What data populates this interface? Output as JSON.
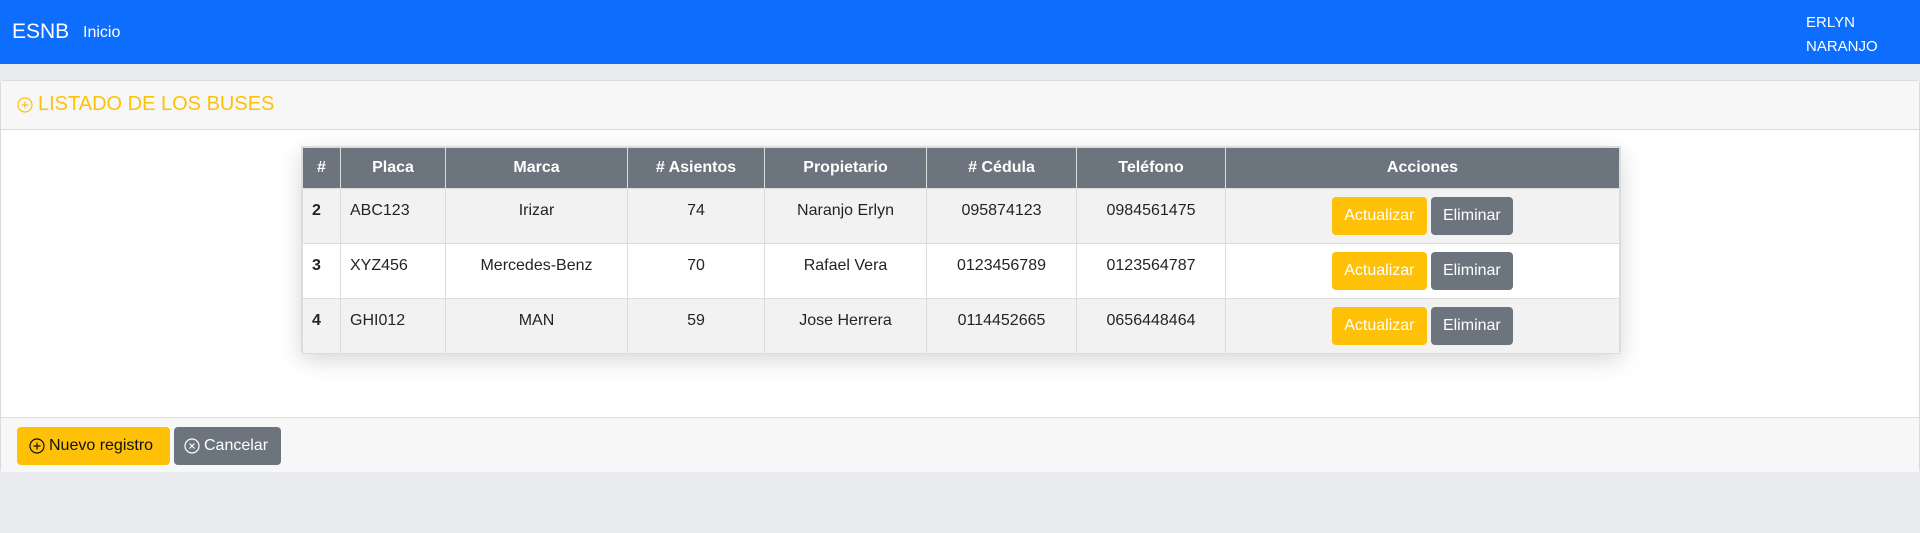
{
  "navbar": {
    "brand": "ESNB",
    "links": [
      "Inicio"
    ],
    "user_line1": "ERLYN",
    "user_line2": "NARANJO"
  },
  "card": {
    "title": "LISTADO DE LOS BUSES",
    "title_icon": "plus-circle-icon"
  },
  "table": {
    "headers": [
      "#",
      "Placa",
      "Marca",
      "# Asientos",
      "Propietario",
      "# Cédula",
      "Teléfono",
      "Acciones"
    ],
    "rows": [
      {
        "id": "2",
        "placa": "ABC123",
        "marca": "Irizar",
        "asientos": "74",
        "propietario": "Naranjo Erlyn",
        "cedula": "095874123",
        "telefono": "0984561475"
      },
      {
        "id": "3",
        "placa": "XYZ456",
        "marca": "Mercedes-Benz",
        "asientos": "70",
        "propietario": "Rafael Vera",
        "cedula": "0123456789",
        "telefono": "0123564787"
      },
      {
        "id": "4",
        "placa": "GHI012",
        "marca": "MAN",
        "asientos": "59",
        "propietario": "Jose Herrera",
        "cedula": "0114452665",
        "telefono": "0656448464"
      }
    ],
    "update_label": "Actualizar",
    "delete_label": "Eliminar"
  },
  "footer": {
    "new_label": "Nuevo registro",
    "new_icon": "plus-circle-icon",
    "cancel_label": "Cancelar",
    "cancel_icon": "x-circle-icon"
  },
  "colors": {
    "navbar": "#0d6efd",
    "warning": "#ffc107",
    "secondary": "#6c757d"
  }
}
